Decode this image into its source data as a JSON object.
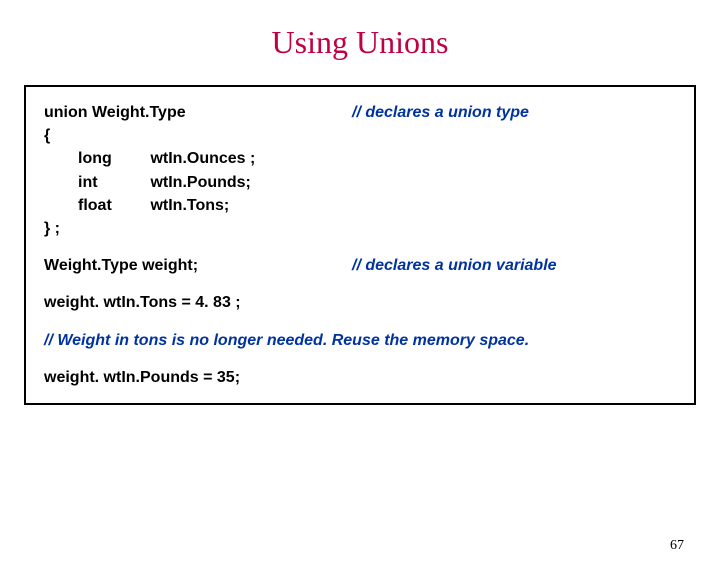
{
  "title": "Using  Unions",
  "code": {
    "line1_left": "union   Weight.Type",
    "line1_right": "// declares a union type",
    "brace_open": "{",
    "decl1_type": "long",
    "decl1_name": "wtIn.Ounces ;",
    "decl2_type": "int",
    "decl2_name": "wtIn.Pounds;",
    "decl3_type": "float",
    "decl3_name": "wtIn.Tons;",
    "brace_close": "}  ;",
    "varline_left": "Weight.Type   weight;",
    "varline_right": "// declares a union variable",
    "assign1": "weight. wtIn.Tons = 4. 83 ;",
    "comment3": "//  Weight in tons is no longer needed. Reuse the memory space.",
    "assign2": "weight. wtIn.Pounds = 35;"
  },
  "page_number": "67"
}
